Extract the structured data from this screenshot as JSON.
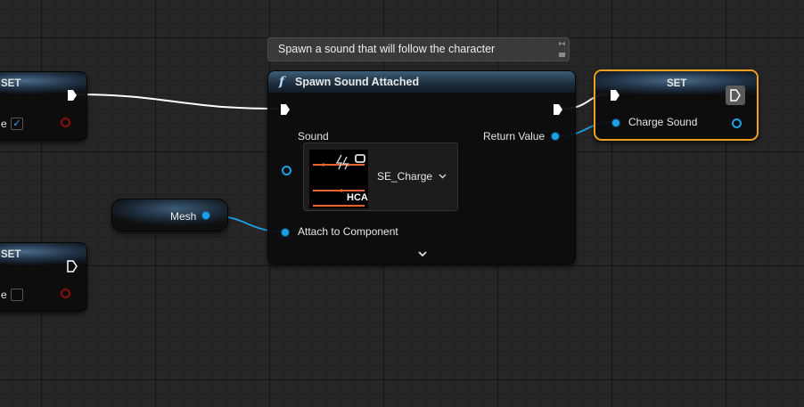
{
  "comment": {
    "text": "Spawn a sound that will follow the character"
  },
  "left_set_top": {
    "title": "SET",
    "input_label": "e",
    "checked": true,
    "check_glyph": "✓"
  },
  "left_set_bottom": {
    "title": "SET",
    "input_label": "e",
    "checked": false
  },
  "mesh_node": {
    "label": "Mesh"
  },
  "spawn_node": {
    "function_glyph": "f",
    "title": "Spawn Sound Attached",
    "sound_label": "Sound",
    "asset_name": "SE_Charge",
    "asset_tag": "HCA",
    "return_label": "Return Value",
    "attach_label": "Attach to Component"
  },
  "set_node": {
    "title": "SET",
    "var_label": "Charge Sound"
  },
  "colors": {
    "object_pin": "#1aa0e6",
    "bool_pin": "#8a0e0e",
    "selection": "#f0a020",
    "exec_wire": "#ffffff",
    "asset_orange": "#e8632b"
  },
  "icons": [
    "function-icon",
    "exec-pin-icon",
    "object-pin-icon",
    "chevron-down-icon",
    "pin-corner-icon",
    "advanced-expand-icon",
    "sound-cue-thumbnail-icon"
  ]
}
